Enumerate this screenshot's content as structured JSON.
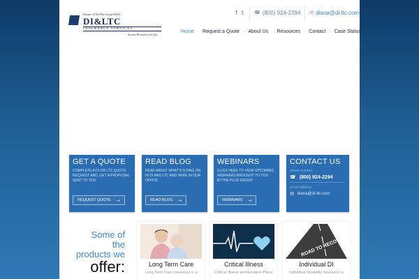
{
  "header": {
    "logo": {
      "tagline_top": "Partner of The Plus Group/GILIS",
      "name": "DI&LTC",
      "bar_text": "INSURANCE SERVICES",
      "slogan": "Income Protection for Life"
    },
    "social": {
      "facebook": "f",
      "twitter": "t"
    },
    "phone": "(800) 924-2294",
    "email": "diana@di-ltc.com",
    "nav": [
      {
        "label": "Home",
        "active": true
      },
      {
        "label": "Request a Quote",
        "active": false
      },
      {
        "label": "About Us",
        "active": false
      },
      {
        "label": "Resources",
        "active": false
      },
      {
        "label": "Contact",
        "active": false
      },
      {
        "label": "Case Status",
        "active": false
      }
    ]
  },
  "cards": {
    "quote": {
      "title": "GET A QUOTE",
      "text": "Complete a DI or LTC quote request and, get a proposal sent to you",
      "button": "REQUEST QUOTE"
    },
    "blog": {
      "title": "READ BLOG",
      "text": "Read about what's going on in DI and LTC and here in our office",
      "button": "READ BLOG"
    },
    "webinars": {
      "title": "WEBINARS",
      "text": "Click here to view upcoming webinars brought to you bythe plus group",
      "button": "WEBINARS"
    },
    "contact": {
      "title": "CONTACT US",
      "phone_label": "phone number",
      "phone": "(800) 924-2294",
      "email_label": "email address",
      "email": "diana@di-ltc.com"
    }
  },
  "offer": {
    "line1": "Some of",
    "line2": "the",
    "line3": "products we",
    "line4": "offer:"
  },
  "products": [
    {
      "title": "Long Term Care",
      "desc": "Long Term Care Insurance is a"
    },
    {
      "title": "Critical Illness",
      "desc": "Critical Illness and Accident Plans"
    },
    {
      "title": "Individual DI",
      "desc": "Individual Disability insurance is"
    }
  ],
  "road_text": "ROAD TO RECOVERY",
  "colors": {
    "accent": "#3a8ad0",
    "card": "#2a6db2",
    "bg_dark": "#0d3b66"
  }
}
